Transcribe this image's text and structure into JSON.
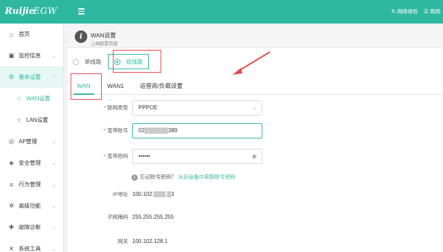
{
  "topbar": {
    "logo": "Ruijie",
    "product": "EGW",
    "actions": [
      {
        "icon": "network-check-icon",
        "label": "网络体检"
      },
      {
        "icon": "user-icon",
        "label": "易网"
      }
    ]
  },
  "sidebar": {
    "items": [
      {
        "label": "首页",
        "icon": "home-icon"
      },
      {
        "label": "监控信息",
        "icon": "monitor-icon"
      },
      {
        "label": "基本设置",
        "icon": "gear-icon"
      },
      {
        "label": "WAN设置",
        "icon": "star-icon"
      },
      {
        "label": "LAN设置",
        "icon": "star-icon"
      },
      {
        "label": "AP管理",
        "icon": "wifi-icon"
      },
      {
        "label": "安全管理",
        "icon": "shield-icon"
      },
      {
        "label": "行为管理",
        "icon": "sliders-icon"
      },
      {
        "label": "高级功能",
        "icon": "settings-icon"
      },
      {
        "label": "故障诊断",
        "icon": "diagnose-icon"
      },
      {
        "label": "系统工具",
        "icon": "tools-icon"
      }
    ]
  },
  "page": {
    "title": "WAN设置",
    "subtitle": "上网配置页面"
  },
  "line_mode": {
    "options": [
      "单线路",
      "双线路"
    ],
    "selected": "双线路"
  },
  "tabs": [
    "WAN",
    "WAN1",
    "运营商/负载设置"
  ],
  "form": {
    "conn_type": {
      "label": "联网类型",
      "value": "PPPOE"
    },
    "account": {
      "label": "宽带账号",
      "value": "02▒▒▒▒▒▒389"
    },
    "password": {
      "label": "宽带密码",
      "value": "••••••"
    },
    "hint": {
      "text": "忘记账号密码？",
      "link": "从旧设备中获取账号密码"
    },
    "ip": {
      "label": "IP地址",
      "value": "100.102.▒▒▒.▒3"
    },
    "mask": {
      "label": "子网掩码",
      "value": "255.255.255.255"
    },
    "gateway": {
      "label": "网关",
      "value": "100.102.128.1"
    }
  },
  "colors": {
    "brand": "#2fb8a1",
    "highlight": "#e54848"
  }
}
